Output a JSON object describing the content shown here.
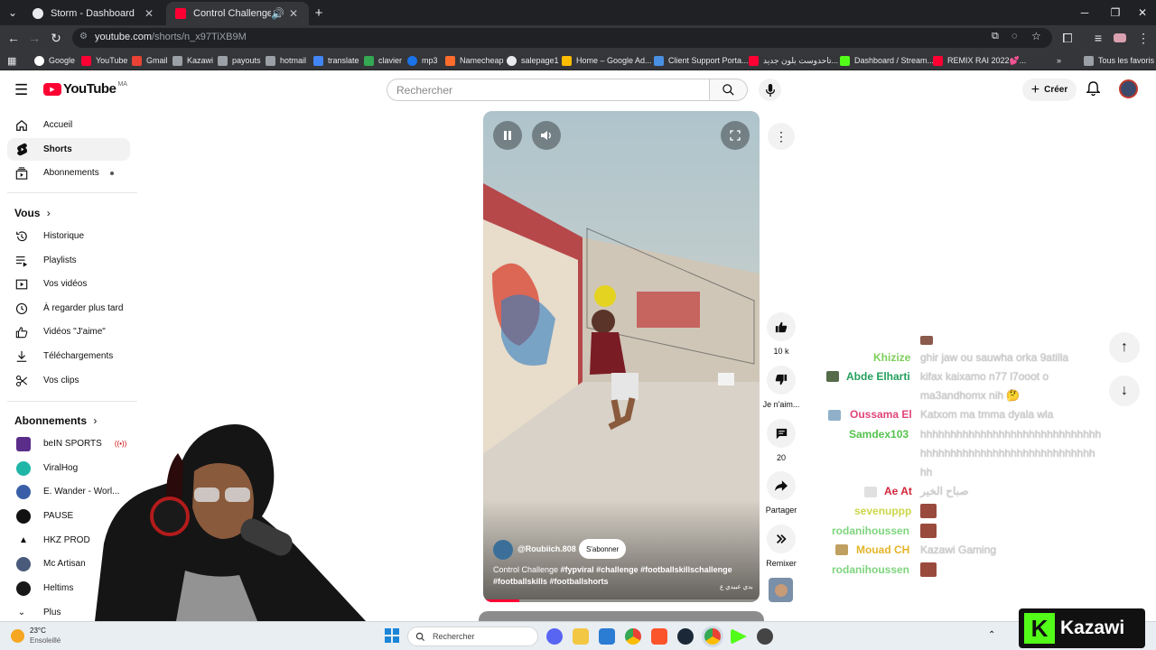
{
  "browser": {
    "tabs": [
      {
        "title": "Storm - Dashboard",
        "active": false
      },
      {
        "title": "Control Challenge #fypviral",
        "active": true
      }
    ],
    "new_tab_label": "+",
    "url_host": "youtube.com",
    "url_path": "/shorts/n_x97TiXB9M",
    "bookmarks": [
      "Google",
      "YouTube",
      "Gmail",
      "Kazawi",
      "payouts",
      "hotmail",
      "translate",
      "clavier",
      "mp3",
      "Namecheap",
      "salepage1",
      "Home – Google Ad...",
      "Client Support Porta...",
      "تاحدوست بلون جديد...",
      "Dashboard / Stream...",
      "REMIX RAI 2022💕..."
    ],
    "all_favorites_label": "Tous les favoris"
  },
  "youtube": {
    "logo_text": "YouTube",
    "logo_country": "MA",
    "search_placeholder": "Rechercher",
    "create_label": "Créer",
    "sidebar": {
      "main": [
        "Accueil",
        "Shorts",
        "Abonnements"
      ],
      "you_heading": "Vous",
      "you_items": [
        "Historique",
        "Playlists",
        "Vos vidéos",
        "À regarder plus tard",
        "Vidéos \"J'aime\"",
        "Téléchargements",
        "Vos clips"
      ],
      "subs_heading": "Abonnements",
      "subs": [
        "beIN SPORTS",
        "ViralHog",
        "E. Wander - Worl...",
        "PAUSE",
        "HKZ PROD",
        "Mc Artisan",
        "Heltims",
        "Plus"
      ]
    },
    "short": {
      "channel": "@Roubiich.808",
      "subscribe_label": "S'abonner",
      "title_plain": "Control Challenge ",
      "hashtags": "#fypviral #challenge #footballskillschallenge #footballskills #footballshorts",
      "watermark": "بدي عبيدي ع",
      "progress": 0.13
    },
    "actions": {
      "like_count": "10 k",
      "dislike_label": "Je n'aim...",
      "comments_count": "20",
      "share_label": "Partager",
      "remix_label": "Remixer"
    }
  },
  "chat": [
    {
      "user": "Khizize",
      "msg": "ghir jaw ou sauwha orka 9atilla",
      "color": "#7ccf5a"
    },
    {
      "user": "Abde Elharti",
      "msg": "kifax kaixamo n77 l7ooot o",
      "color": "#23a05c"
    },
    {
      "user": "",
      "msg": "ma3andhomx nih 🤔",
      "color": "#23a05c"
    },
    {
      "user": "Oussama El",
      "msg": "Katxom ma tmma dyala wla",
      "color": "#e0457b"
    },
    {
      "user": "Samdex103",
      "msg": "hhhhhhhhhhhhhhhhhhhhhhhhhhhhhh",
      "color": "#55c24e"
    },
    {
      "user": "",
      "msg": "hhhhhhhhhhhhhhhhhhhhhhhhhhhhh",
      "color": "#55c24e"
    },
    {
      "user": "",
      "msg": "hh",
      "color": "#55c24e"
    },
    {
      "user": "Ae At",
      "msg": "صباح الخير",
      "color": "#d0263a"
    },
    {
      "user": "sevenuppp",
      "msg": "",
      "color": "#ccd64a"
    },
    {
      "user": "rodanihoussen",
      "msg": "",
      "color": "#7ed47e"
    },
    {
      "user": "Mouad CH",
      "msg": "Kazawi Gaming",
      "color": "#e3b52a"
    },
    {
      "user": "rodanihoussen",
      "msg": "",
      "color": "#7ed47e"
    }
  ],
  "taskbar": {
    "temp": "23°C",
    "weather": "Ensoleillé",
    "search_label": "Rechercher"
  },
  "overlay_brand": "Kazawi"
}
